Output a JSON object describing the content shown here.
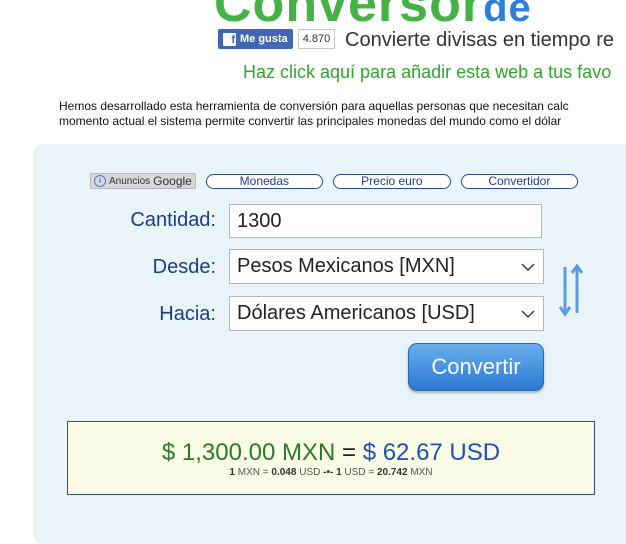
{
  "header": {
    "logo_main": "Conversor",
    "logo_tail": "de",
    "fb_like_label": "Me gusta",
    "fb_like_count": "4.870",
    "tagline": "Convierte divisas en tiempo re",
    "favorites_link": "Haz click aquí para añadir esta web a tus favo"
  },
  "intro": {
    "line1": "Hemos desarrollado esta herramienta de conversión para aquellas personas que necesitan calc",
    "line2": "momento actual el sistema permite convertir las principales monedas del mundo como el dólar"
  },
  "adbar": {
    "ads_label": "Anuncios",
    "google_label": "Google",
    "links": [
      "Monedas",
      "Precio euro",
      "Convertidor"
    ]
  },
  "form": {
    "amount_label": "Cantidad:",
    "amount_value": "1300",
    "from_label": "Desde:",
    "from_value": "Pesos Mexicanos [MXN]",
    "to_label": "Hacia:",
    "to_value": "Dólares Americanos [USD]",
    "convert_label": "Convertir"
  },
  "result": {
    "from_amount": "$ 1,300.00 MXN",
    "equals": "=",
    "to_amount": "$ 62.67 USD",
    "rate1_qty": "1",
    "rate1_from": "MXN",
    "rate1_eq": "=",
    "rate1_value": "0.048",
    "rate1_to": "USD",
    "rate_sep": "-•-",
    "rate2_qty": "1",
    "rate2_from": "USD",
    "rate2_eq": "=",
    "rate2_value": "20.742",
    "rate2_to": "MXN"
  },
  "icons": {
    "facebook": "facebook-f-icon",
    "info": "info-icon",
    "chevron": "chevron-down-icon",
    "swap": "swap-arrows-icon"
  },
  "colors": {
    "logo_green": "#44b244",
    "link_green": "#2da82d",
    "label_blue": "#1b3d8a",
    "button_blue": "#2a78d2",
    "result_bg": "#fbfce6",
    "panel_bg": "#e8f4f7"
  }
}
